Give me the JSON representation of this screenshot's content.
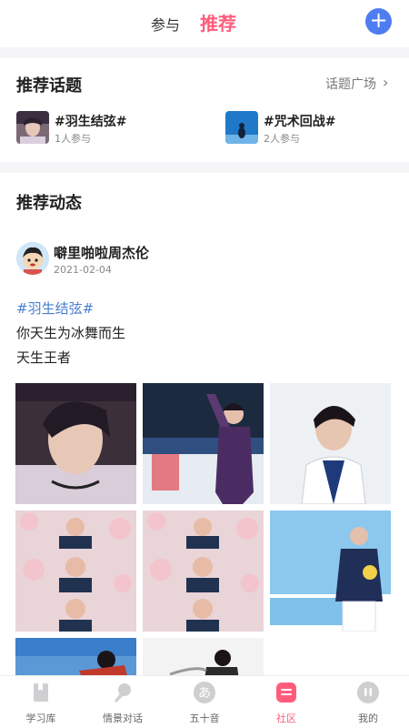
{
  "header": {
    "tab_participate": "参与",
    "tab_recommend": "推荐",
    "add_icon": "plus-icon"
  },
  "topics": {
    "title": "推荐话题",
    "plaza_link": "话题广场",
    "items": [
      {
        "name": "#羽生结弦#",
        "count": "1人参与"
      },
      {
        "name": "#咒术回战#",
        "count": "2人参与"
      }
    ]
  },
  "feed": {
    "title": "推荐动态",
    "post": {
      "author": "噼里啪啦周杰伦",
      "date": "2021-02-04",
      "hashtag": "#羽生结弦#",
      "lines": [
        "你天生为冰舞而生",
        "天生王者"
      ]
    }
  },
  "nav": {
    "items": [
      {
        "label": "学习库",
        "icon": "book-icon"
      },
      {
        "label": "情景对话",
        "icon": "microphone-icon"
      },
      {
        "label": "五十音",
        "icon": "kana-icon"
      },
      {
        "label": "社区",
        "icon": "community-icon"
      },
      {
        "label": "我的",
        "icon": "profile-icon"
      }
    ],
    "active_index": 3
  },
  "colors": {
    "accent_pink": "#ff5c7c",
    "accent_blue": "#4f7cf0",
    "hashtag_blue": "#4a7fd0"
  }
}
